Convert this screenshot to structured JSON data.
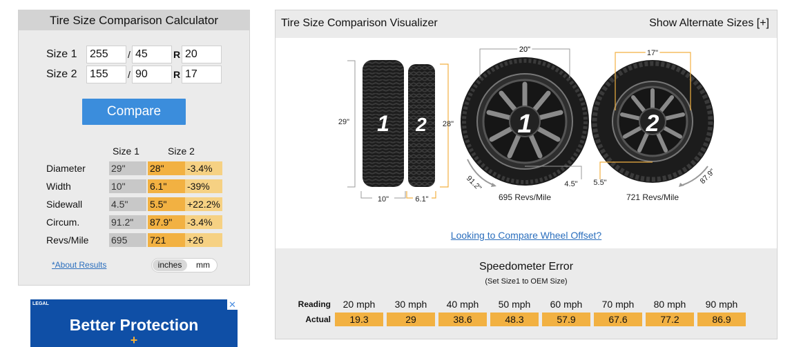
{
  "calculator": {
    "title": "Tire Size Comparison Calculator",
    "size1": {
      "label": "Size 1",
      "width": "255",
      "aspect": "45",
      "rim": "20"
    },
    "size2": {
      "label": "Size 2",
      "width": "155",
      "aspect": "90",
      "rim": "17"
    },
    "slash": "/",
    "rim_prefix": "R",
    "compare_label": "Compare",
    "results_headers": {
      "size1": "Size 1",
      "size2": "Size 2"
    },
    "results": [
      {
        "name": "Diameter",
        "v1": "29\"",
        "v2": "28\"",
        "diff": "-3.4%"
      },
      {
        "name": "Width",
        "v1": "10\"",
        "v2": "6.1\"",
        "diff": "-39%"
      },
      {
        "name": "Sidewall",
        "v1": "4.5\"",
        "v2": "5.5\"",
        "diff": "+22.2%"
      },
      {
        "name": "Circum.",
        "v1": "91.2\"",
        "v2": "87.9\"",
        "diff": "-3.4%"
      },
      {
        "name": "Revs/Mile",
        "v1": "695",
        "v2": "721",
        "diff": "+26"
      }
    ],
    "about_link": "*About Results",
    "units": {
      "selected": "inches",
      "other": "mm"
    }
  },
  "ad": {
    "tag": "LEGAL",
    "headline": "Better Protection",
    "plus": "+",
    "close": "✕",
    "colors": {
      "background": "#0f4fa6",
      "accent": "#f6b035"
    }
  },
  "visualizer": {
    "title": "Tire Size Comparison Visualizer",
    "alt_sizes": "Show Alternate Sizes [+]",
    "side": {
      "tire1_number": "1",
      "tire2_number": "2",
      "tire1_diameter": "29\"",
      "tire2_diameter": "28\"",
      "tire1_width": "10\"",
      "tire2_width": "6.1\""
    },
    "wheel1": {
      "number": "1",
      "rim": "20\"",
      "sidewall": "4.5\"",
      "circumference": "91.2\"",
      "revs": "695 Revs/Mile"
    },
    "wheel2": {
      "number": "2",
      "rim": "17\"",
      "sidewall": "5.5\"",
      "circumference": "87.9\"",
      "revs": "721 Revs/Mile"
    },
    "offset_link": "Looking to Compare Wheel Offset?"
  },
  "speedometer": {
    "title": "Speedometer Error",
    "subtitle": "(Set Size1 to OEM Size)",
    "reading_label": "Reading",
    "actual_label": "Actual",
    "readings": [
      "20 mph",
      "30 mph",
      "40 mph",
      "50 mph",
      "60 mph",
      "70 mph",
      "80 mph",
      "90 mph"
    ],
    "actuals": [
      "19.3",
      "29",
      "38.6",
      "48.3",
      "57.9",
      "67.6",
      "77.2",
      "86.9"
    ]
  },
  "colors": {
    "accent_orange": "#f2b142",
    "light_orange": "#f6d183",
    "button_blue": "#3b8ddc",
    "link_blue": "#2a6ebd",
    "panel_gray": "#ebebeb"
  }
}
